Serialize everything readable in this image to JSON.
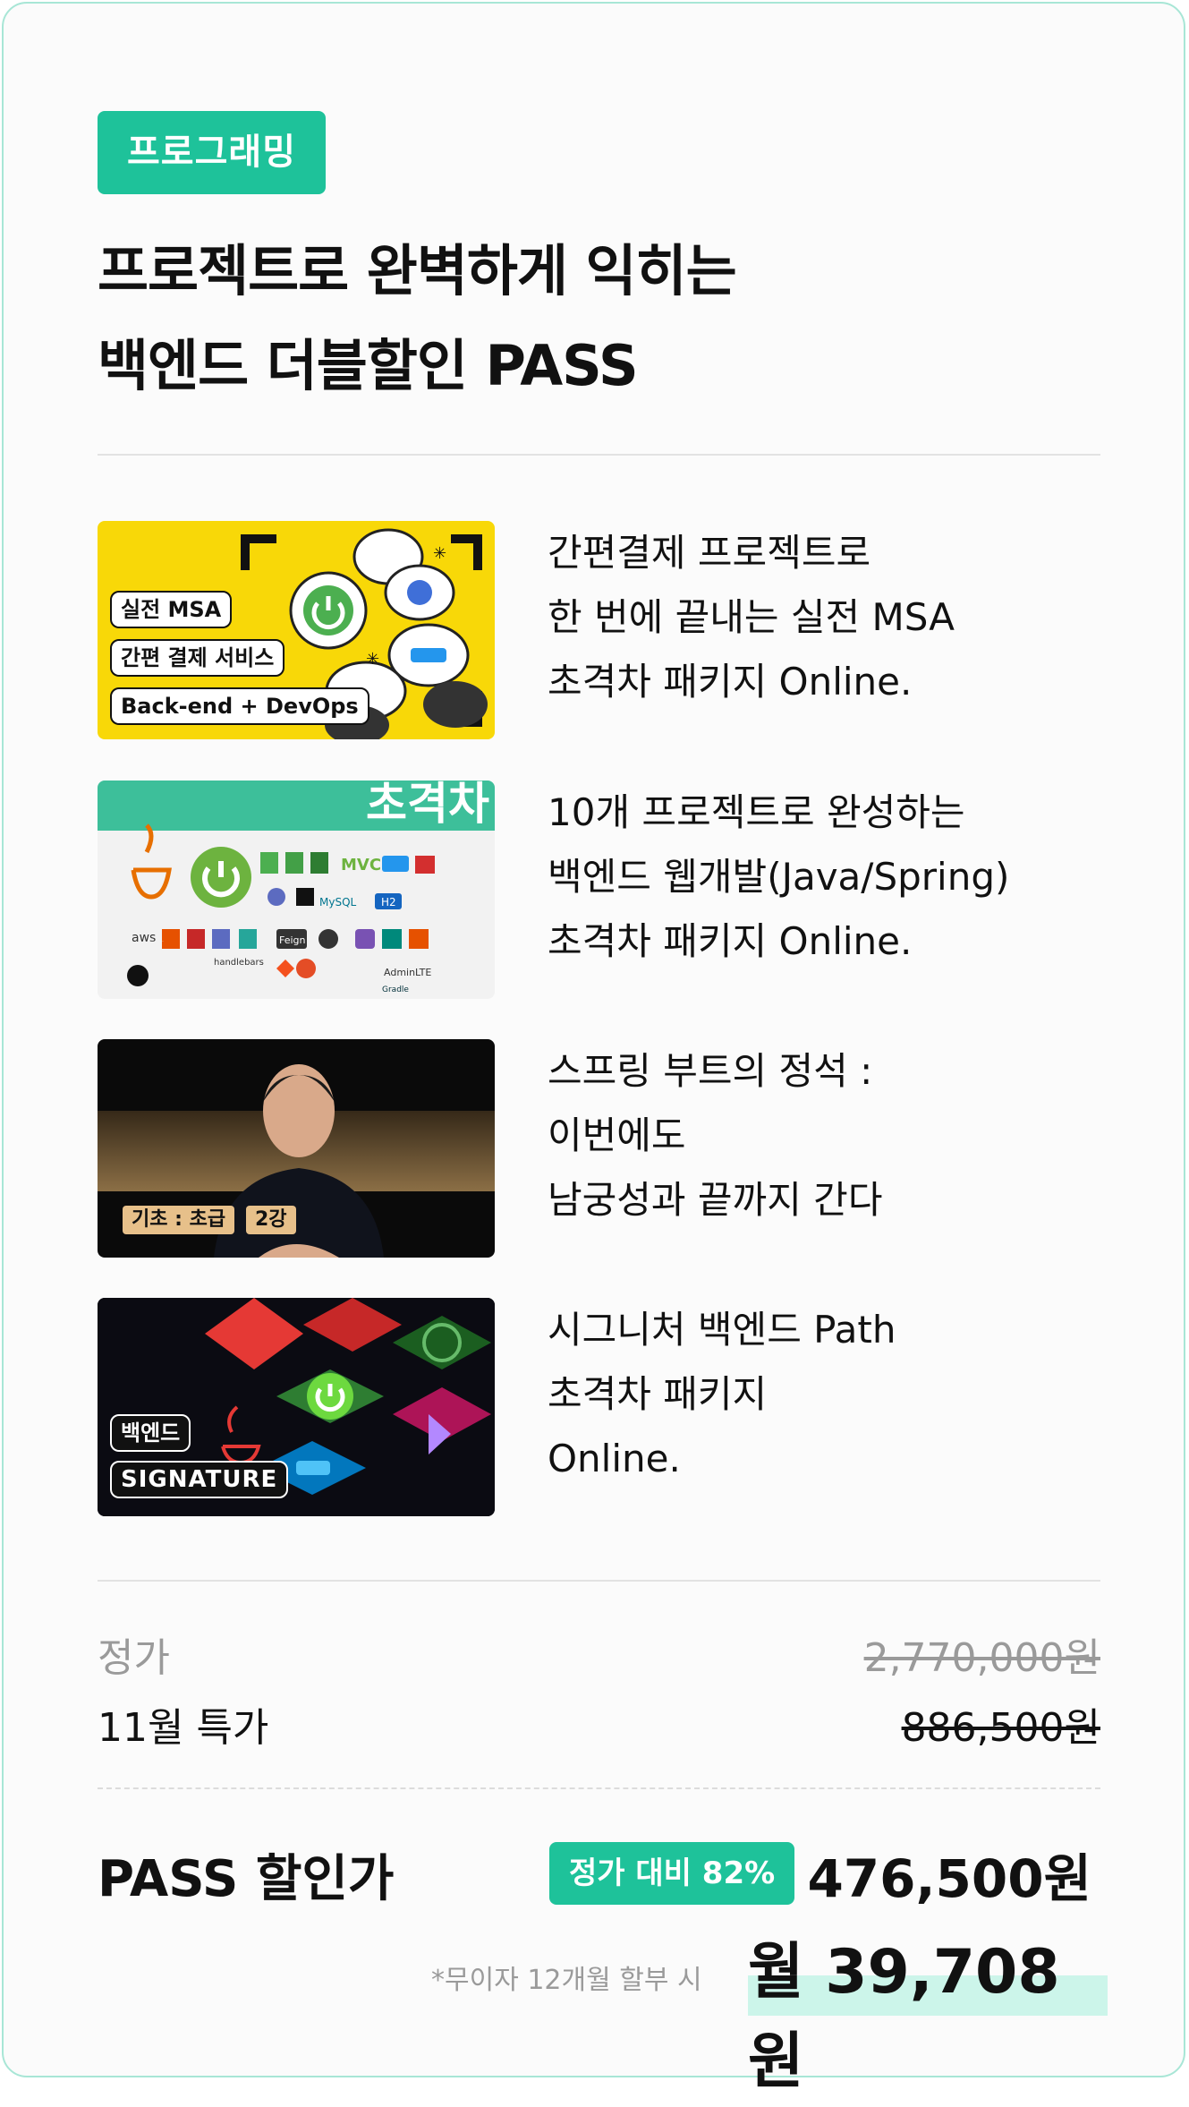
{
  "category_tag": "프로그래밍",
  "title": {
    "line1": "프로젝트로 완벽하게 익히는",
    "line2": "백엔드 더블할인 PASS"
  },
  "courses": [
    {
      "thumb_labels": [
        "실전 MSA",
        "간편 결제 서비스",
        "Back-end + DevOps"
      ],
      "desc_lines": [
        "간편결제 프로젝트로",
        "한 번에 끝내는 실전 MSA",
        "초격차 패키지 Online."
      ]
    },
    {
      "thumb_banner": "초격차",
      "thumb_icons": [
        "aws",
        "MVC",
        "MySQL",
        "Feign",
        "H2",
        "handlebars",
        "Gradle",
        "AdminLTE"
      ],
      "desc_lines": [
        "10개 프로젝트로 완성하는",
        "백엔드 웹개발(Java/Spring)",
        "초격차 패키지 Online."
      ]
    },
    {
      "thumb_labels": [
        "기초 : 초급",
        "2강"
      ],
      "desc_lines": [
        "스프링 부트의 정석 :",
        "이번에도",
        "남궁성과 끝까지 간다"
      ]
    },
    {
      "thumb_labels": [
        "백엔드",
        "SIGNATURE"
      ],
      "desc_lines": [
        "시그니처 백엔드 Path",
        "초격차 패키지",
        "Online."
      ]
    }
  ],
  "pricing": {
    "regular_label": "정가",
    "regular_price": "2,770,000원",
    "special_label": "11월 특가",
    "special_price": "886,500원",
    "pass_label": "PASS 할인가",
    "discount_badge": "정가 대비 82%",
    "pass_price": "476,500원",
    "installment_note": "*무이자 12개월 할부 시",
    "monthly_price": "월 39,708원"
  },
  "colors": {
    "accent": "#1ec29a",
    "highlight": "#ccf5ea",
    "border": "#a8e6d6"
  }
}
